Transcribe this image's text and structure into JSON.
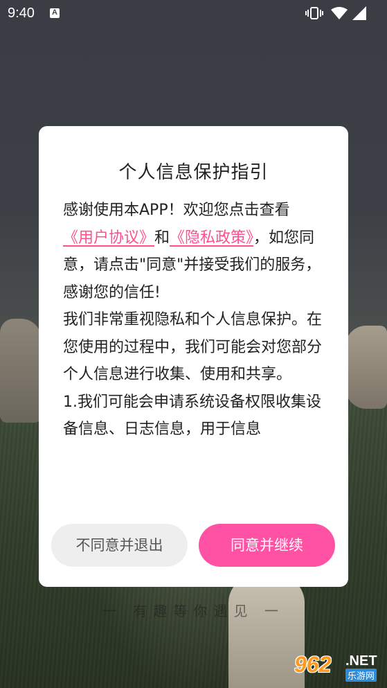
{
  "status": {
    "time": "9:40"
  },
  "dialog": {
    "title": "个人信息保护指引",
    "body": {
      "intro_1": "感谢使用本APP！欢迎您点击查看",
      "link_user_agreement": "《用户协议》",
      "joiner": "和",
      "link_privacy_policy": "《隐私政策》",
      "intro_2": "，如您同意，请点击\"同意\"并接受我们的服务，感谢您的信任!",
      "paragraph_2": "我们非常重视隐私和个人信息保护。在您使用的过程中，我们可能会对您部分个人信息进行收集、使用和共享。",
      "paragraph_3": "1.我们可能会申请系统设备权限收集设备信息、日志信息，用于信息"
    },
    "decline_label": "不同意并退出",
    "accept_label": "同意并继续"
  },
  "tagline": "一 有趣等你遇见 一",
  "watermark": {
    "number": "962",
    "suffix": ".NET",
    "site_name": "乐游网"
  },
  "colors": {
    "accent": "#ff52a4",
    "link": "#ff4f8f",
    "decline_bg": "#eeeeee"
  }
}
